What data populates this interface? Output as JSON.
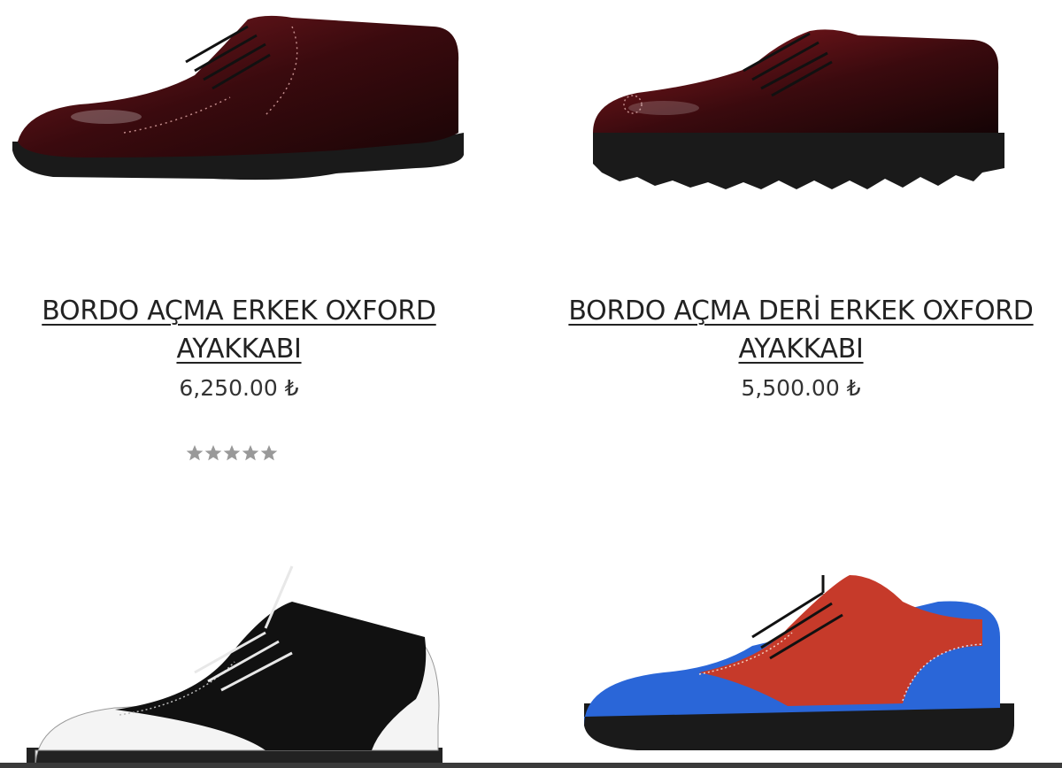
{
  "products": [
    {
      "title_line1": "BORDO AÇMA ERKEK OXFORD",
      "title_line2": "AYAKKABI",
      "price": "6,250.00 ₺",
      "rating": 5,
      "image": "burgundy-brogue-oxford"
    },
    {
      "title_line1": "BORDO AÇMA DERİ ERKEK OXFORD",
      "title_line2": "AYAKKABI",
      "price": "5,500.00 ₺",
      "image": "burgundy-oxford-lug-sole"
    },
    {
      "image": "black-white-spectator-oxford"
    },
    {
      "image": "blue-red-wingtip-oxford"
    }
  ],
  "colors": {
    "star": "#999999",
    "title": "#222222",
    "burgundy": "#4a0c10",
    "blue": "#2a66d8",
    "red": "#c63a2a"
  }
}
